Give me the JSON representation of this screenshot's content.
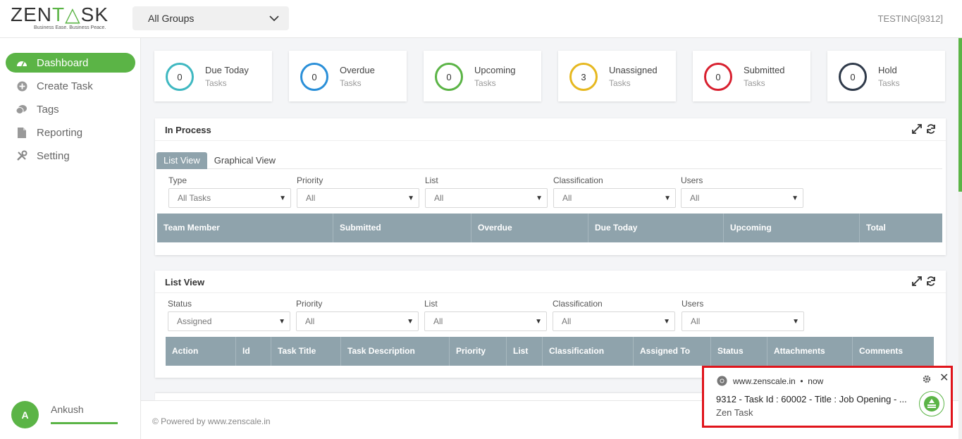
{
  "header": {
    "logo_text_a": "ZEN",
    "logo_text_b": "T",
    "logo_text_c": "SK",
    "logo_tagline": "Business Ease. Business Peace.",
    "group_select": "All Groups",
    "account": "TESTING[9312]"
  },
  "sidebar": {
    "items": [
      {
        "label": "Dashboard",
        "icon": "dashboard-icon"
      },
      {
        "label": "Create Task",
        "icon": "plus-circle-icon"
      },
      {
        "label": "Tags",
        "icon": "tag-icon"
      },
      {
        "label": "Reporting",
        "icon": "file-icon"
      },
      {
        "label": "Setting",
        "icon": "tools-icon"
      }
    ],
    "user": {
      "initial": "A",
      "name": "Ankush"
    }
  },
  "stats": [
    {
      "count": "0",
      "label": "Due Today",
      "sub": "Tasks",
      "color": "#3fb8c1"
    },
    {
      "count": "0",
      "label": "Overdue",
      "sub": "Tasks",
      "color": "#2a8fd8"
    },
    {
      "count": "0",
      "label": "Upcoming",
      "sub": "Tasks",
      "color": "#5bb446"
    },
    {
      "count": "3",
      "label": "Unassigned",
      "sub": "Tasks",
      "color": "#e6b820"
    },
    {
      "count": "0",
      "label": "Submitted",
      "sub": "Tasks",
      "color": "#d8202f"
    },
    {
      "count": "0",
      "label": "Hold",
      "sub": "Tasks",
      "color": "#2f3a4a"
    }
  ],
  "in_process": {
    "title": "In Process",
    "tabs": [
      "List View",
      "Graphical View"
    ],
    "filters": [
      {
        "label": "Type",
        "value": "All Tasks"
      },
      {
        "label": "Priority",
        "value": "All"
      },
      {
        "label": "List",
        "value": "All"
      },
      {
        "label": "Classification",
        "value": "All"
      },
      {
        "label": "Users",
        "value": "All"
      }
    ],
    "columns": [
      "Team Member",
      "Submitted",
      "Overdue",
      "Due Today",
      "Upcoming",
      "Total"
    ]
  },
  "list_view": {
    "title": "List View",
    "filters": [
      {
        "label": "Status",
        "value": "Assigned"
      },
      {
        "label": "Priority",
        "value": "All"
      },
      {
        "label": "List",
        "value": "All"
      },
      {
        "label": "Classification",
        "value": "All"
      },
      {
        "label": "Users",
        "value": "All"
      }
    ],
    "columns": [
      "Action",
      "Id",
      "Task Title",
      "Task Description",
      "Priority",
      "List",
      "Classification",
      "Assigned To",
      "Status",
      "Attachments",
      "Comments"
    ]
  },
  "footer": {
    "text": "© Powered by www.zenscale.in"
  },
  "notification": {
    "source": "www.zenscale.in",
    "time": "now",
    "message": "9312 - Task Id : 60002 - Title : Job Opening  - ...",
    "app": "Zen Task"
  },
  "colors": {
    "accent": "#5bb446",
    "table_header": "#8fa3ac",
    "notif_border": "#e0141b"
  }
}
